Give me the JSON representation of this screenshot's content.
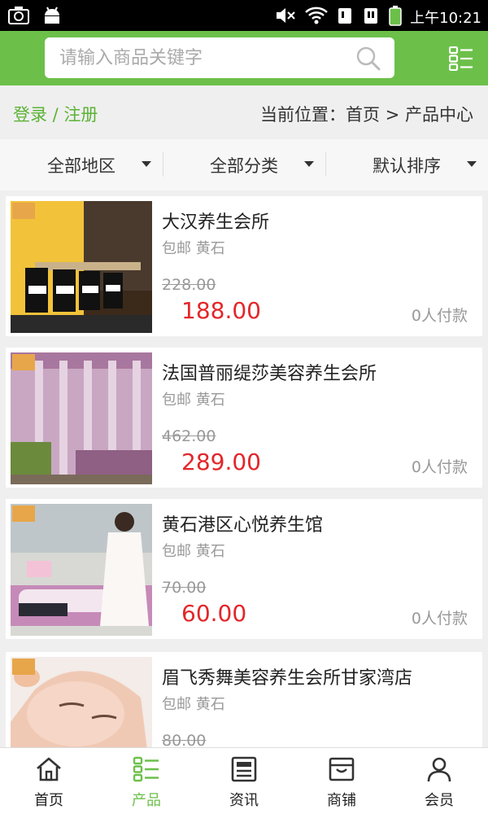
{
  "status_bar": {
    "time": "上午10:21",
    "icons": [
      "screenshot-icon",
      "android-icon",
      "mute-icon",
      "wifi-icon",
      "sim1-icon",
      "sim2-icon",
      "battery-icon"
    ]
  },
  "header": {
    "search_placeholder": "请输入商品关键字",
    "accent_color": "#6cc04a"
  },
  "breadcrumb_bar": {
    "login_label": "登录 / 注册",
    "location": "当前位置：首页 > 产品中心"
  },
  "filters": [
    {
      "label": "全部地区"
    },
    {
      "label": "全部分类"
    },
    {
      "label": "默认排序"
    }
  ],
  "products": [
    {
      "name": "大汉养生会所",
      "tags": "包邮 黄石",
      "original_price": "228.00",
      "price": "188.00",
      "paid": "0人付款"
    },
    {
      "name": "法国普丽缇莎美容养生会所",
      "tags": "包邮 黄石",
      "original_price": "462.00",
      "price": "289.00",
      "paid": "0人付款"
    },
    {
      "name": "黄石港区心悦养生馆",
      "tags": "包邮 黄石",
      "original_price": "70.00",
      "price": "60.00",
      "paid": "0人付款"
    },
    {
      "name": "眉飞秀舞美容养生会所甘家湾店",
      "tags": "包邮 黄石",
      "original_price": "80.00",
      "price": "",
      "paid": ""
    }
  ],
  "tabs": [
    {
      "label": "首页",
      "icon": "home-icon"
    },
    {
      "label": "产品",
      "icon": "list-icon",
      "active": true
    },
    {
      "label": "资讯",
      "icon": "news-icon"
    },
    {
      "label": "商铺",
      "icon": "shop-icon"
    },
    {
      "label": "会员",
      "icon": "user-icon"
    }
  ]
}
